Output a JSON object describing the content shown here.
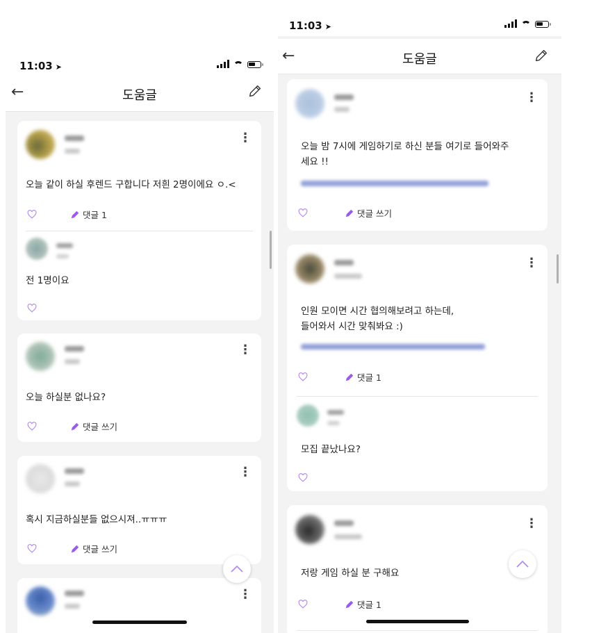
{
  "status": {
    "time": "11:03",
    "location_icon": "location-arrow-icon"
  },
  "header": {
    "title": "도움글",
    "back_icon": "back-arrow-icon",
    "write_icon": "pencil-icon"
  },
  "colors": {
    "accent": "#9b59f0",
    "heart": "#b58cf0"
  },
  "left_screen": {
    "posts": [
      {
        "text": "오늘 같이 하실 후렌드 구합니다 저흰 2명이에요 ㅇ.<",
        "comment_label": "댓글 1",
        "reply": {
          "text": "전 1명이요"
        }
      },
      {
        "text": "오늘 하실분 없나요?",
        "comment_label": "댓글 쓰기"
      },
      {
        "text": "혹시 지금하실분들 없으시져..ㅠㅠㅠ",
        "comment_label": "댓글 쓰기"
      }
    ]
  },
  "right_screen": {
    "posts": [
      {
        "text": "오늘 밤 7시에 게임하기로 하신 분들 여기로 들어와주\n세요 !!",
        "comment_label": "댓글 쓰기"
      },
      {
        "text": "인원 모이면 시간 협의해보려고 하는데,\n들어와서 시간 맞춰봐요 :)",
        "comment_label": "댓글 1",
        "reply": {
          "text": "모집 끝났나요?"
        }
      },
      {
        "text": "저랑 게임 하실 분 구해요",
        "comment_label": "댓글 1"
      }
    ]
  }
}
